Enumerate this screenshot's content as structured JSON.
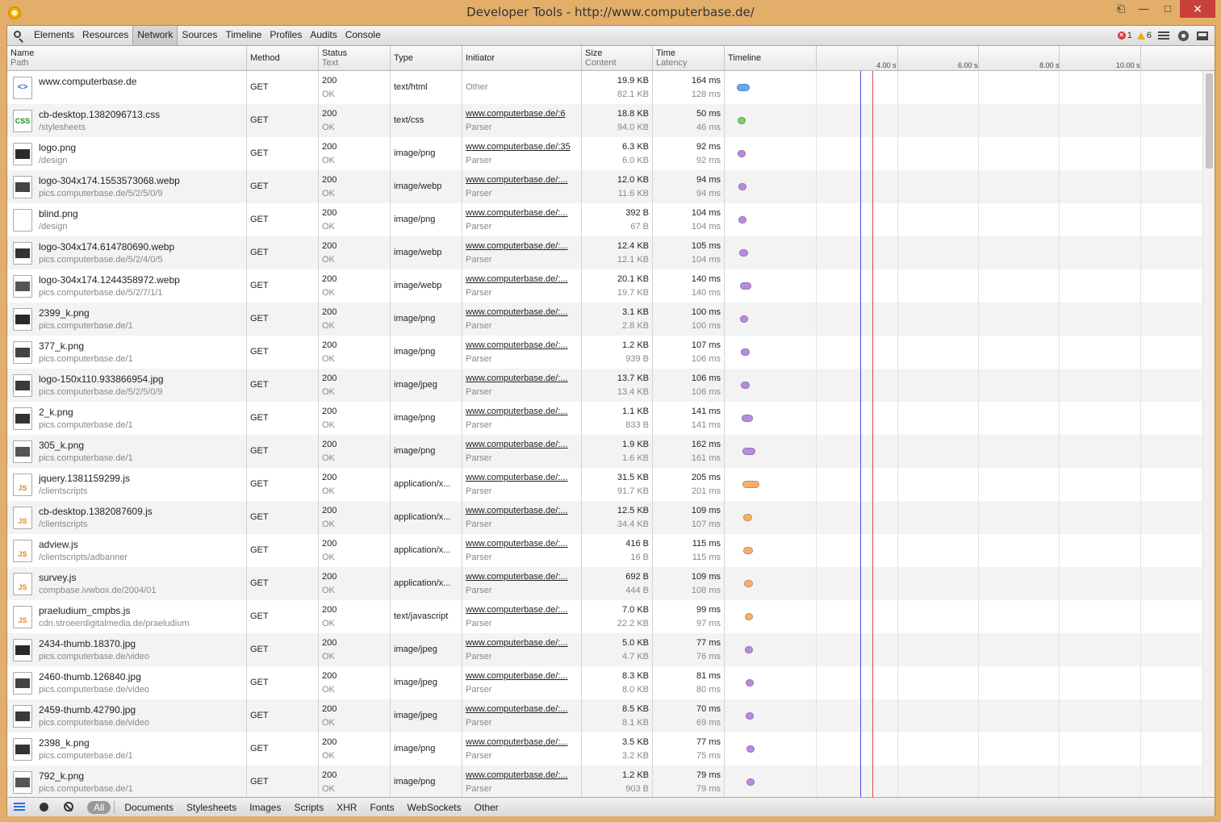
{
  "window": {
    "title": "Developer Tools - http://www.computerbase.de/"
  },
  "toolbar": {
    "tabs": [
      "Elements",
      "Resources",
      "Network",
      "Sources",
      "Timeline",
      "Profiles",
      "Audits",
      "Console"
    ],
    "active_tab": "Network",
    "error_count": "1",
    "warning_count": "6"
  },
  "header": {
    "name": "Name",
    "path": "Path",
    "method": "Method",
    "status": "Status",
    "status_text": "Text",
    "type": "Type",
    "initiator": "Initiator",
    "size": "Size",
    "content": "Content",
    "time": "Time",
    "latency": "Latency",
    "timeline": "Timeline",
    "ticks": [
      "4.00 s",
      "6.00 s",
      "8.00 s",
      "10.00 s"
    ]
  },
  "rows": [
    {
      "name": "www.computerbase.de",
      "path": "",
      "method": "GET",
      "status": "200",
      "status_text": "OK",
      "type": "text/html",
      "initiator": "",
      "initiator_type": "Other",
      "size": "19.9 KB",
      "content": "82.1 KB",
      "time": "164 ms",
      "latency": "128 ms",
      "icon": "html",
      "color": "#6aa7ee"
    },
    {
      "name": "cb-desktop.1382096713.css",
      "path": "/stylesheets",
      "method": "GET",
      "status": "200",
      "status_text": "OK",
      "type": "text/css",
      "initiator": "www.computerbase.de/:6",
      "initiator_type": "Parser",
      "size": "18.8 KB",
      "content": "94.0 KB",
      "time": "50 ms",
      "latency": "46 ms",
      "icon": "css",
      "color": "#7ccf6a"
    },
    {
      "name": "logo.png",
      "path": "/design",
      "method": "GET",
      "status": "200",
      "status_text": "OK",
      "type": "image/png",
      "initiator": "www.computerbase.de/:35",
      "initiator_type": "Parser",
      "size": "6.3 KB",
      "content": "6.0 KB",
      "time": "92 ms",
      "latency": "92 ms",
      "icon": "img",
      "color": "#b88be0"
    },
    {
      "name": "logo-304x174.1553573068.webp",
      "path": "pics.computerbase.de/5/2/5/0/9",
      "method": "GET",
      "status": "200",
      "status_text": "OK",
      "type": "image/webp",
      "initiator": "www.computerbase.de/:...",
      "initiator_type": "Parser",
      "size": "12.0 KB",
      "content": "11.6 KB",
      "time": "94 ms",
      "latency": "94 ms",
      "icon": "img",
      "color": "#b88be0"
    },
    {
      "name": "blind.png",
      "path": "/design",
      "method": "GET",
      "status": "200",
      "status_text": "OK",
      "type": "image/png",
      "initiator": "www.computerbase.de/:...",
      "initiator_type": "Parser",
      "size": "392 B",
      "content": "67 B",
      "time": "104 ms",
      "latency": "104 ms",
      "icon": "blank",
      "color": "#b88be0"
    },
    {
      "name": "logo-304x174.614780690.webp",
      "path": "pics.computerbase.de/5/2/4/0/5",
      "method": "GET",
      "status": "200",
      "status_text": "OK",
      "type": "image/webp",
      "initiator": "www.computerbase.de/:...",
      "initiator_type": "Parser",
      "size": "12.4 KB",
      "content": "12.1 KB",
      "time": "105 ms",
      "latency": "104 ms",
      "icon": "img",
      "color": "#b88be0"
    },
    {
      "name": "logo-304x174.1244358972.webp",
      "path": "pics.computerbase.de/5/2/7/1/1",
      "method": "GET",
      "status": "200",
      "status_text": "OK",
      "type": "image/webp",
      "initiator": "www.computerbase.de/:...",
      "initiator_type": "Parser",
      "size": "20.1 KB",
      "content": "19.7 KB",
      "time": "140 ms",
      "latency": "140 ms",
      "icon": "img",
      "color": "#b88be0"
    },
    {
      "name": "2399_k.png",
      "path": "pics.computerbase.de/1",
      "method": "GET",
      "status": "200",
      "status_text": "OK",
      "type": "image/png",
      "initiator": "www.computerbase.de/:...",
      "initiator_type": "Parser",
      "size": "3.1 KB",
      "content": "2.8 KB",
      "time": "100 ms",
      "latency": "100 ms",
      "icon": "img",
      "color": "#b88be0"
    },
    {
      "name": "377_k.png",
      "path": "pics.computerbase.de/1",
      "method": "GET",
      "status": "200",
      "status_text": "OK",
      "type": "image/png",
      "initiator": "www.computerbase.de/:...",
      "initiator_type": "Parser",
      "size": "1.2 KB",
      "content": "939 B",
      "time": "107 ms",
      "latency": "106 ms",
      "icon": "img",
      "color": "#b88be0"
    },
    {
      "name": "logo-150x110.933866954.jpg",
      "path": "pics.computerbase.de/5/2/5/0/9",
      "method": "GET",
      "status": "200",
      "status_text": "OK",
      "type": "image/jpeg",
      "initiator": "www.computerbase.de/:...",
      "initiator_type": "Parser",
      "size": "13.7 KB",
      "content": "13.4 KB",
      "time": "106 ms",
      "latency": "106 ms",
      "icon": "img",
      "color": "#b88be0"
    },
    {
      "name": "2_k.png",
      "path": "pics.computerbase.de/1",
      "method": "GET",
      "status": "200",
      "status_text": "OK",
      "type": "image/png",
      "initiator": "www.computerbase.de/:...",
      "initiator_type": "Parser",
      "size": "1.1 KB",
      "content": "833 B",
      "time": "141 ms",
      "latency": "141 ms",
      "icon": "img",
      "color": "#b88be0"
    },
    {
      "name": "305_k.png",
      "path": "pics.computerbase.de/1",
      "method": "GET",
      "status": "200",
      "status_text": "OK",
      "type": "image/png",
      "initiator": "www.computerbase.de/:...",
      "initiator_type": "Parser",
      "size": "1.9 KB",
      "content": "1.6 KB",
      "time": "162 ms",
      "latency": "161 ms",
      "icon": "img",
      "color": "#b88be0"
    },
    {
      "name": "jquery.1381159299.js",
      "path": "/clientscripts",
      "method": "GET",
      "status": "200",
      "status_text": "OK",
      "type": "application/x...",
      "initiator": "www.computerbase.de/:...",
      "initiator_type": "Parser",
      "size": "31.5 KB",
      "content": "91.7 KB",
      "time": "205 ms",
      "latency": "201 ms",
      "icon": "js",
      "color": "#f5b06a"
    },
    {
      "name": "cb-desktop.1382087609.js",
      "path": "/clientscripts",
      "method": "GET",
      "status": "200",
      "status_text": "OK",
      "type": "application/x...",
      "initiator": "www.computerbase.de/:...",
      "initiator_type": "Parser",
      "size": "12.5 KB",
      "content": "34.4 KB",
      "time": "109 ms",
      "latency": "107 ms",
      "icon": "js",
      "color": "#f5b06a"
    },
    {
      "name": "adview.js",
      "path": "/clientscripts/adbanner",
      "method": "GET",
      "status": "200",
      "status_text": "OK",
      "type": "application/x...",
      "initiator": "www.computerbase.de/:...",
      "initiator_type": "Parser",
      "size": "416 B",
      "content": "16 B",
      "time": "115 ms",
      "latency": "115 ms",
      "icon": "js",
      "color": "#f5b06a"
    },
    {
      "name": "survey.js",
      "path": "compbase.ivwbox.de/2004/01",
      "method": "GET",
      "status": "200",
      "status_text": "OK",
      "type": "application/x...",
      "initiator": "www.computerbase.de/:...",
      "initiator_type": "Parser",
      "size": "692 B",
      "content": "444 B",
      "time": "109 ms",
      "latency": "108 ms",
      "icon": "js",
      "color": "#f5b06a"
    },
    {
      "name": "praeludium_cmpbs.js",
      "path": "cdn.stroeerdigitalmedia.de/praeludium",
      "method": "GET",
      "status": "200",
      "status_text": "OK",
      "type": "text/javascript",
      "initiator": "www.computerbase.de/:...",
      "initiator_type": "Parser",
      "size": "7.0 KB",
      "content": "22.2 KB",
      "time": "99 ms",
      "latency": "97 ms",
      "icon": "js",
      "color": "#f5b06a"
    },
    {
      "name": "2434-thumb.18370.jpg",
      "path": "pics.computerbase.de/video",
      "method": "GET",
      "status": "200",
      "status_text": "OK",
      "type": "image/jpeg",
      "initiator": "www.computerbase.de/:...",
      "initiator_type": "Parser",
      "size": "5.0 KB",
      "content": "4.7 KB",
      "time": "77 ms",
      "latency": "76 ms",
      "icon": "img",
      "color": "#b88be0"
    },
    {
      "name": "2460-thumb.126840.jpg",
      "path": "pics.computerbase.de/video",
      "method": "GET",
      "status": "200",
      "status_text": "OK",
      "type": "image/jpeg",
      "initiator": "www.computerbase.de/:...",
      "initiator_type": "Parser",
      "size": "8.3 KB",
      "content": "8.0 KB",
      "time": "81 ms",
      "latency": "80 ms",
      "icon": "img",
      "color": "#b88be0"
    },
    {
      "name": "2459-thumb.42790.jpg",
      "path": "pics.computerbase.de/video",
      "method": "GET",
      "status": "200",
      "status_text": "OK",
      "type": "image/jpeg",
      "initiator": "www.computerbase.de/:...",
      "initiator_type": "Parser",
      "size": "8.5 KB",
      "content": "8.1 KB",
      "time": "70 ms",
      "latency": "69 ms",
      "icon": "img",
      "color": "#b88be0"
    },
    {
      "name": "2398_k.png",
      "path": "pics.computerbase.de/1",
      "method": "GET",
      "status": "200",
      "status_text": "OK",
      "type": "image/png",
      "initiator": "www.computerbase.de/:...",
      "initiator_type": "Parser",
      "size": "3.5 KB",
      "content": "3.2 KB",
      "time": "77 ms",
      "latency": "75 ms",
      "icon": "img",
      "color": "#b88be0"
    },
    {
      "name": "792_k.png",
      "path": "pics.computerbase.de/1",
      "method": "GET",
      "status": "200",
      "status_text": "OK",
      "type": "image/png",
      "initiator": "www.computerbase.de/:...",
      "initiator_type": "Parser",
      "size": "1.2 KB",
      "content": "903 B",
      "time": "79 ms",
      "latency": "79 ms",
      "icon": "img",
      "color": "#b88be0"
    }
  ],
  "footer": {
    "filters": [
      "All",
      "Documents",
      "Stylesheets",
      "Images",
      "Scripts",
      "XHR",
      "Fonts",
      "WebSockets",
      "Other"
    ],
    "active_filter": "All"
  },
  "icons": {
    "html": "html-file-icon",
    "css": "css-file-icon",
    "js": "js-file-icon",
    "img": "image-file-icon",
    "blank": "blank-file-icon"
  }
}
